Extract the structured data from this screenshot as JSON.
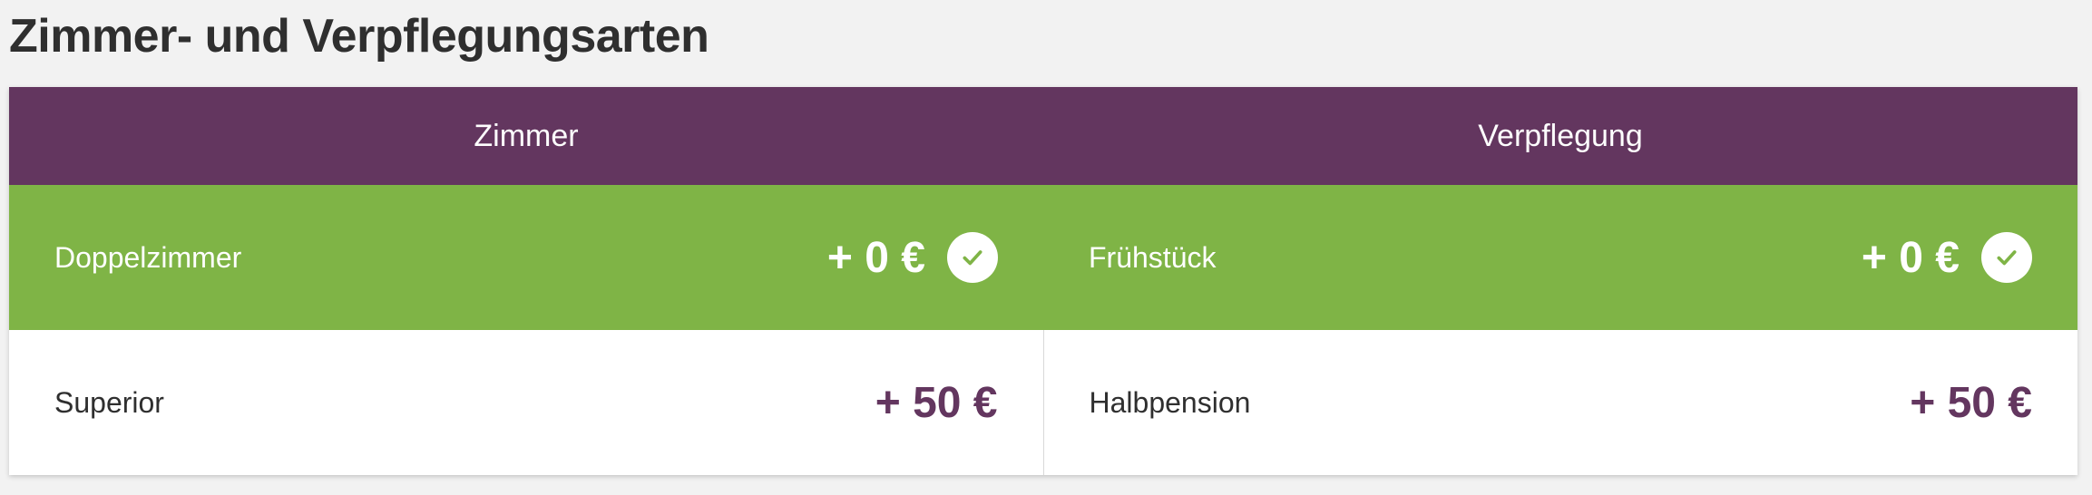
{
  "page": {
    "title": "Zimmer- und Verpflegungsarten"
  },
  "table": {
    "headers": [
      "Zimmer",
      "Verpflegung"
    ],
    "rows": [
      {
        "selected": true,
        "cells": [
          {
            "label": "Doppelzimmer",
            "price": "+ 0 €",
            "icon": "check-icon"
          },
          {
            "label": "Frühstück",
            "price": "+ 0 €",
            "icon": "check-icon"
          }
        ]
      },
      {
        "selected": false,
        "cells": [
          {
            "label": "Superior",
            "price": "+ 50 €"
          },
          {
            "label": "Halbpension",
            "price": "+ 50 €"
          }
        ]
      }
    ]
  },
  "colors": {
    "header_bg": "#63365f",
    "selected_bg": "#7fb446",
    "price_accent": "#63365f",
    "page_bg": "#f2f2f2"
  }
}
